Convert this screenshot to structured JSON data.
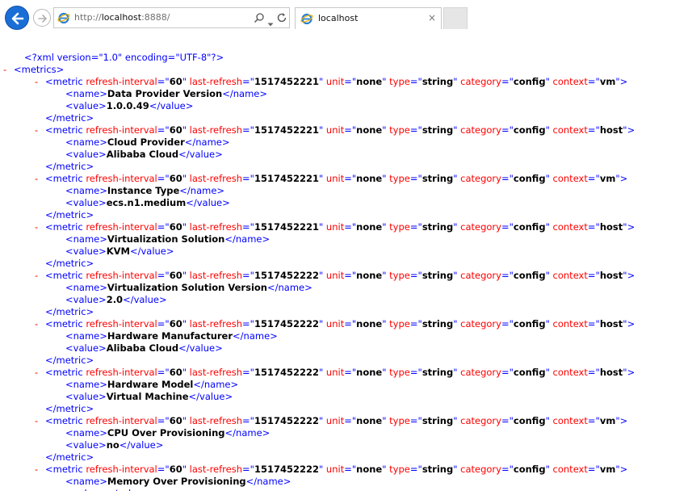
{
  "browser": {
    "url_prefix": "http://",
    "url_host": "localhost",
    "url_suffix": ":8888/",
    "search_glyph": "⌕",
    "dropdown_glyph": "▾",
    "refresh_glyph": "↻",
    "tab_title": "localhost",
    "tab_close": "×",
    "icons": [
      "back-arrow-icon",
      "forward-arrow-icon",
      "ie-logo-icon",
      "search-icon",
      "refresh-icon",
      "close-icon"
    ],
    "colors": {
      "back_button": "#1a6fd6",
      "new_tab": "#e6e6e6"
    }
  },
  "xml": {
    "declaration": "<?xml version=\"1.0\" encoding=\"UTF-8\"?>",
    "toggle": "-",
    "root": "metrics",
    "colors": {
      "markup": "#0000ff",
      "attr_name": "#ff0000",
      "value": "#000000",
      "toggle": "#ff0000"
    },
    "metrics": [
      {
        "refresh_interval": "60",
        "last_refresh": "1517452221",
        "unit": "none",
        "type": "string",
        "category": "config",
        "context": "vm",
        "name": "Data Provider Version",
        "value": "1.0.0.49"
      },
      {
        "refresh_interval": "60",
        "last_refresh": "1517452221",
        "unit": "none",
        "type": "string",
        "category": "config",
        "context": "host",
        "name": "Cloud Provider",
        "value": "Alibaba Cloud"
      },
      {
        "refresh_interval": "60",
        "last_refresh": "1517452221",
        "unit": "none",
        "type": "string",
        "category": "config",
        "context": "vm",
        "name": "Instance Type",
        "value": "ecs.n1.medium"
      },
      {
        "refresh_interval": "60",
        "last_refresh": "1517452221",
        "unit": "none",
        "type": "string",
        "category": "config",
        "context": "host",
        "name": "Virtualization Solution",
        "value": "KVM"
      },
      {
        "refresh_interval": "60",
        "last_refresh": "1517452222",
        "unit": "none",
        "type": "string",
        "category": "config",
        "context": "host",
        "name": "Virtualization Solution Version",
        "value": "2.0"
      },
      {
        "refresh_interval": "60",
        "last_refresh": "1517452222",
        "unit": "none",
        "type": "string",
        "category": "config",
        "context": "host",
        "name": "Hardware Manufacturer",
        "value": "Alibaba Cloud"
      },
      {
        "refresh_interval": "60",
        "last_refresh": "1517452222",
        "unit": "none",
        "type": "string",
        "category": "config",
        "context": "host",
        "name": "Hardware Model",
        "value": "Virtual Machine"
      },
      {
        "refresh_interval": "60",
        "last_refresh": "1517452222",
        "unit": "none",
        "type": "string",
        "category": "config",
        "context": "vm",
        "name": "CPU Over Provisioning",
        "value": "no"
      },
      {
        "refresh_interval": "60",
        "last_refresh": "1517452222",
        "unit": "none",
        "type": "string",
        "category": "config",
        "context": "vm",
        "name": "Memory Over Provisioning",
        "value": ""
      }
    ]
  }
}
